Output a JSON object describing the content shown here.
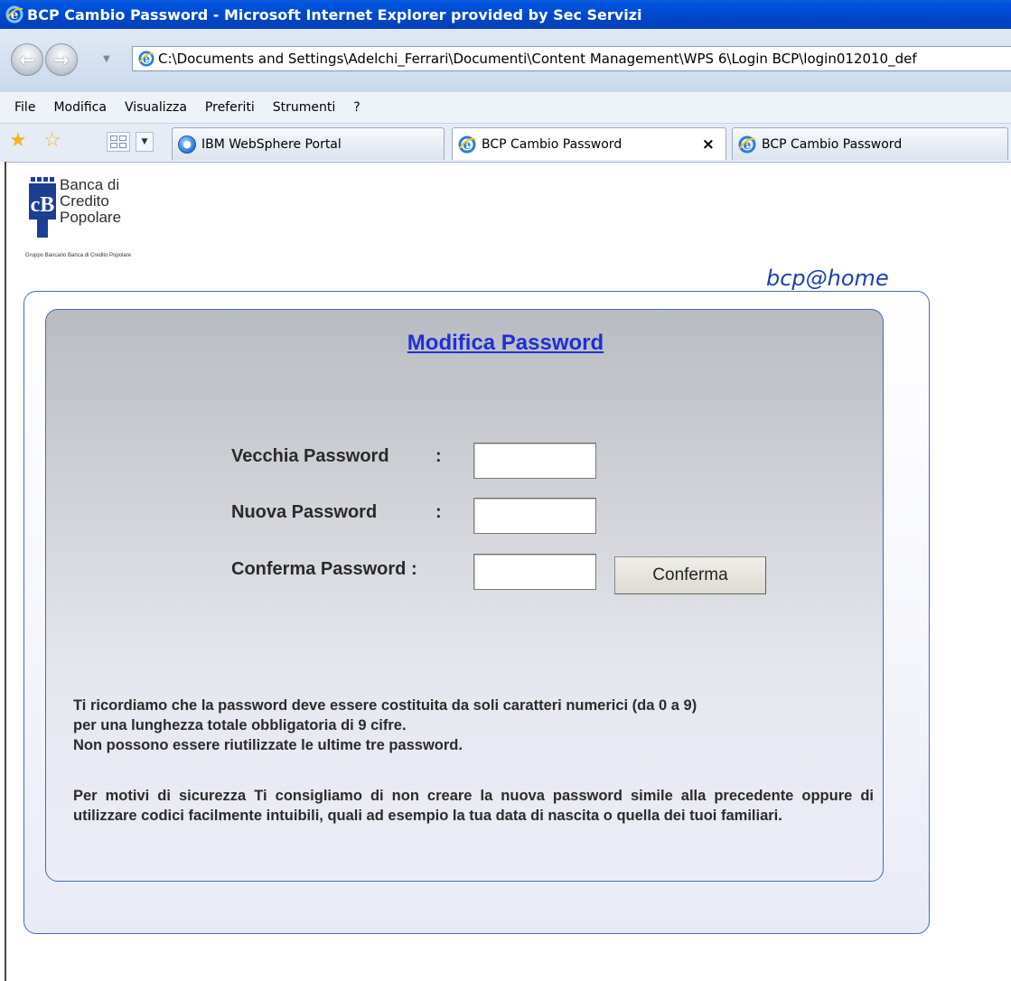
{
  "window": {
    "title": "BCP Cambio Password - Microsoft Internet Explorer provided by Sec Servizi"
  },
  "addressbar": {
    "url": "C:\\Documents and Settings\\Adelchi_Ferrari\\Documenti\\Content Management\\WPS 6\\Login BCP\\login012010_def"
  },
  "menu": {
    "items": [
      "File",
      "Modifica",
      "Visualizza",
      "Preferiti",
      "Strumenti",
      "?"
    ]
  },
  "tabs": [
    {
      "label": "IBM WebSphere Portal",
      "icon": "globe-icon",
      "active": false
    },
    {
      "label": "BCP Cambio Password",
      "icon": "ie-icon",
      "active": true,
      "close": "×"
    },
    {
      "label": "BCP Cambio Password",
      "icon": "ie-icon",
      "active": false
    }
  ],
  "logo": {
    "lines": [
      "Banca di",
      "Credito",
      "Popolare"
    ],
    "tagline": "Gruppo Bancario Banca di Credito Popolare"
  },
  "brandline": "bcp@home",
  "form": {
    "title": "Modifica Password",
    "old_label": "Vecchia Password",
    "new_label": "Nuova Password",
    "confirm_label": "Conferma Password :",
    "colon": ":",
    "old_value": "",
    "new_value": "",
    "confirm_value": "",
    "submit_label": "Conferma"
  },
  "info": {
    "rules_line1": "Ti ricordiamo che la password deve essere costituita da soli caratteri numerici (da 0 a 9)",
    "rules_line2": "per una lunghezza totale obbligatoria di 9 cifre.",
    "rules_line3": "Non possono essere riutilizzate le ultime tre password.",
    "security_text": "Per motivi di sicurezza Ti consigliamo di non creare la nuova password simile alla precedente oppure di utilizzare codici facilmente intuibili, quali ad esempio la tua data di nascita o quella dei tuoi familiari."
  },
  "colors": {
    "title_blue": "#1e31d2",
    "brand_blue": "#1d3fae",
    "panel_border": "#3d6fb3"
  }
}
